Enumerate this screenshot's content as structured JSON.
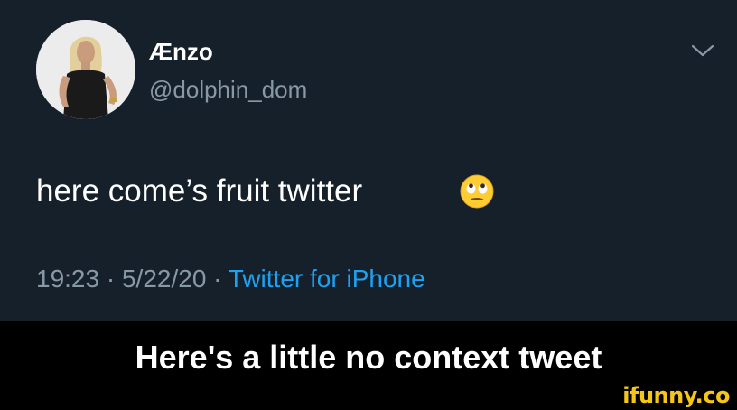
{
  "tweet": {
    "display_name": "Ænzo",
    "handle": "@dolphin_dom",
    "text": "here come’s fruit twitter",
    "emoji_icon": "face-with-rolling-eyes-emoji",
    "time": "19:23",
    "separator": " · ",
    "date": "5/22/20",
    "source": "Twitter for iPhone",
    "menu_icon": "chevron-down-icon",
    "avatar_icon": "profile-photo"
  },
  "caption": "Here's a little no context tweet",
  "watermark": "ifunny.co",
  "colors": {
    "tweet_background": "#15202b",
    "primary_text": "#ffffff",
    "secondary_text": "#8899a6",
    "link": "#1da1f2",
    "caption_background": "#000000",
    "watermark": "#f5c518"
  }
}
